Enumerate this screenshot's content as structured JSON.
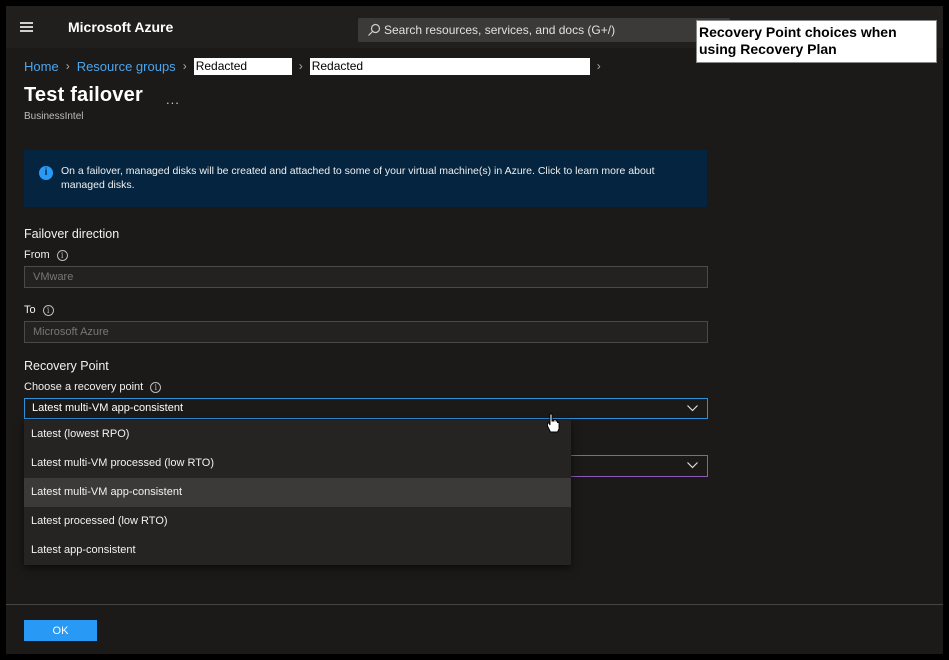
{
  "app": {
    "brand": "Microsoft Azure"
  },
  "search": {
    "placeholder": "Search resources, services, and docs (G+/)"
  },
  "callout": {
    "text": "Recovery Point choices when using Recovery Plan"
  },
  "breadcrumb": {
    "items": [
      "Home",
      "Resource groups"
    ],
    "redacted": [
      "Redacted",
      "Redacted"
    ]
  },
  "page": {
    "title": "Test failover",
    "more": "...",
    "subtitle": "BusinessIntel"
  },
  "info": {
    "icon": "info-icon",
    "text": "On a failover, managed disks will be created and attached to some of your virtual machine(s) in Azure. Click to learn more about managed disks."
  },
  "failover": {
    "heading": "Failover direction",
    "from_label": "From",
    "from_value": "VMware",
    "to_label": "To",
    "to_value": "Microsoft Azure"
  },
  "recovery": {
    "heading": "Recovery Point",
    "choose_label": "Choose a recovery point",
    "selected": "Latest multi-VM app-consistent",
    "options": [
      "Latest (lowest RPO)",
      "Latest multi-VM processed (low RTO)",
      "Latest multi-VM app-consistent",
      "Latest processed (low RTO)",
      "Latest app-consistent"
    ]
  },
  "footer": {
    "ok_label": "OK"
  },
  "colors": {
    "accent": "#2899f5",
    "link": "#4aa5ef",
    "banner": "#04243f"
  }
}
